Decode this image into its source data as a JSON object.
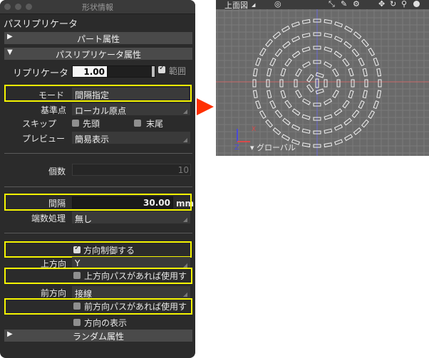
{
  "panel": {
    "window_title": "形状情報",
    "header": "パスリプリケータ",
    "part_attr": "パート属性",
    "path_rep_attr": "パスリプリケータ属性",
    "replicator_label": "リプリケータ",
    "replicator_value": "1.00",
    "range_label": "範囲",
    "mode_label": "モード",
    "mode_value": "間隔指定",
    "base_label": "基準点",
    "base_value": "ローカル原点",
    "skip_label": "スキップ",
    "skip_start": "先頭",
    "skip_end": "末尾",
    "preview_label": "プレビュー",
    "preview_value": "簡易表示",
    "count_label": "個数",
    "count_value": "10",
    "interval_label": "間隔",
    "interval_value": "30.00",
    "interval_unit": "mm",
    "endpoint_label": "端数処理",
    "endpoint_value": "無し",
    "direction_control": "方向制御する",
    "up_label": "上方向",
    "up_value": "Y",
    "up_path_use": "上方向パスがあれば使用す",
    "front_label": "前方向",
    "front_value": "接線",
    "front_path_use": "前方向パスがあれば使用す",
    "show_direction": "方向の表示",
    "random_attr": "ランダム属性"
  },
  "viewport": {
    "view_name": "上面図",
    "global_label": "▾ グローバル",
    "axis_z": "Z",
    "axis_x": "X"
  },
  "colors": {
    "highlight": "#f5f500",
    "arrow": "#ff3000",
    "grid_bg": "#6a6a6a"
  }
}
